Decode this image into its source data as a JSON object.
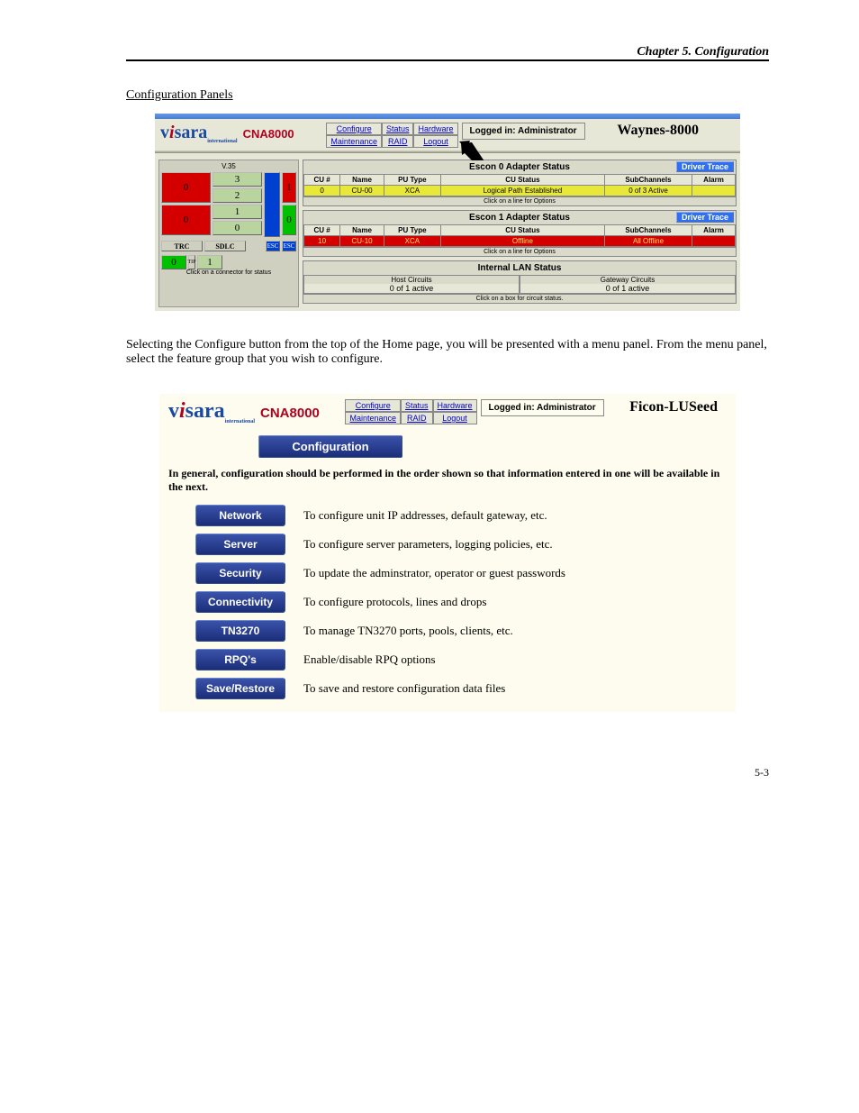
{
  "doc": {
    "chapter_header": "Chapter 5.  Configuration",
    "section_title": "Configuration Panels",
    "page_number": "5-3"
  },
  "shot1": {
    "logo": {
      "vi": "v",
      "i": "i",
      "sara": "sara",
      "intl": "international"
    },
    "product": "CNA8000",
    "nav": {
      "r1c1": "Configure",
      "r1c2": "Status",
      "r1c3": "Hardware",
      "r2c1": "Maintenance",
      "r2c2": "RAID",
      "r2c3": "Logout"
    },
    "logged_in": "Logged in: Administrator",
    "nodename": "Waynes-8000",
    "leftpanel": {
      "v35": "V.35",
      "nums": [
        "3",
        "2",
        "1",
        "0"
      ],
      "trc": "TRC",
      "sdlc": "SDLC",
      "esc1": "ESC",
      "esc2": "ESC",
      "tiny": "TIP",
      "hint": "Click on a connector for status"
    },
    "escon0": {
      "title": "Escon 0 Adapter Status",
      "driver_btn": "Driver Trace",
      "headers": [
        "CU #",
        "Name",
        "PU Type",
        "CU Status",
        "SubChannels",
        "Alarm"
      ],
      "row": [
        "0",
        "CU-00",
        "XCA",
        "Logical Path Established",
        "0 of 3 Active",
        ""
      ],
      "hint": "Click on a line for Options"
    },
    "escon1": {
      "title": "Escon 1 Adapter Status",
      "driver_btn": "Driver Trace",
      "headers": [
        "CU #",
        "Name",
        "PU Type",
        "CU Status",
        "SubChannels",
        "Alarm"
      ],
      "row": [
        "10",
        "CU-10",
        "XCA",
        "Offline",
        "All Offline",
        ""
      ],
      "hint": "Click on a line for Options"
    },
    "lan": {
      "title": "Internal LAN Status",
      "host_h": "Host Circuits",
      "gw_h": "Gateway Circuits",
      "host_v": "0 of 1 active",
      "gw_v": "0 of 1 active",
      "hint": "Click on a box for circuit status."
    }
  },
  "explain": "Selecting the Configure button from the top of the Home page, you will be presented with a menu panel. From the menu panel, select the feature group that you wish to configure.",
  "shot2": {
    "product": "CNA8000",
    "nav": {
      "r1c1": "Configure",
      "r1c2": "Status",
      "r1c3": "Hardware",
      "r2c1": "Maintenance",
      "r2c2": "RAID",
      "r2c3": "Logout"
    },
    "logged_in": "Logged in: Administrator",
    "nodename": "Ficon-LUSeed",
    "confbar": "Configuration",
    "note": "In general, configuration should be performed in the order shown so that information entered in one will be available in the next.",
    "rows": [
      {
        "label": "Network",
        "desc": "To configure unit IP addresses, default gateway, etc."
      },
      {
        "label": "Server",
        "desc": "To configure server parameters, logging policies, etc."
      },
      {
        "label": "Security",
        "desc": "To update the adminstrator, operator or guest passwords"
      },
      {
        "label": "Connectivity",
        "desc": "To configure protocols, lines and drops"
      },
      {
        "label": "TN3270",
        "desc": "To manage TN3270 ports, pools, clients, etc."
      },
      {
        "label": "RPQ's",
        "desc": "Enable/disable RPQ options"
      },
      {
        "label": "Save/Restore",
        "desc": "To save and restore configuration data files"
      }
    ]
  }
}
